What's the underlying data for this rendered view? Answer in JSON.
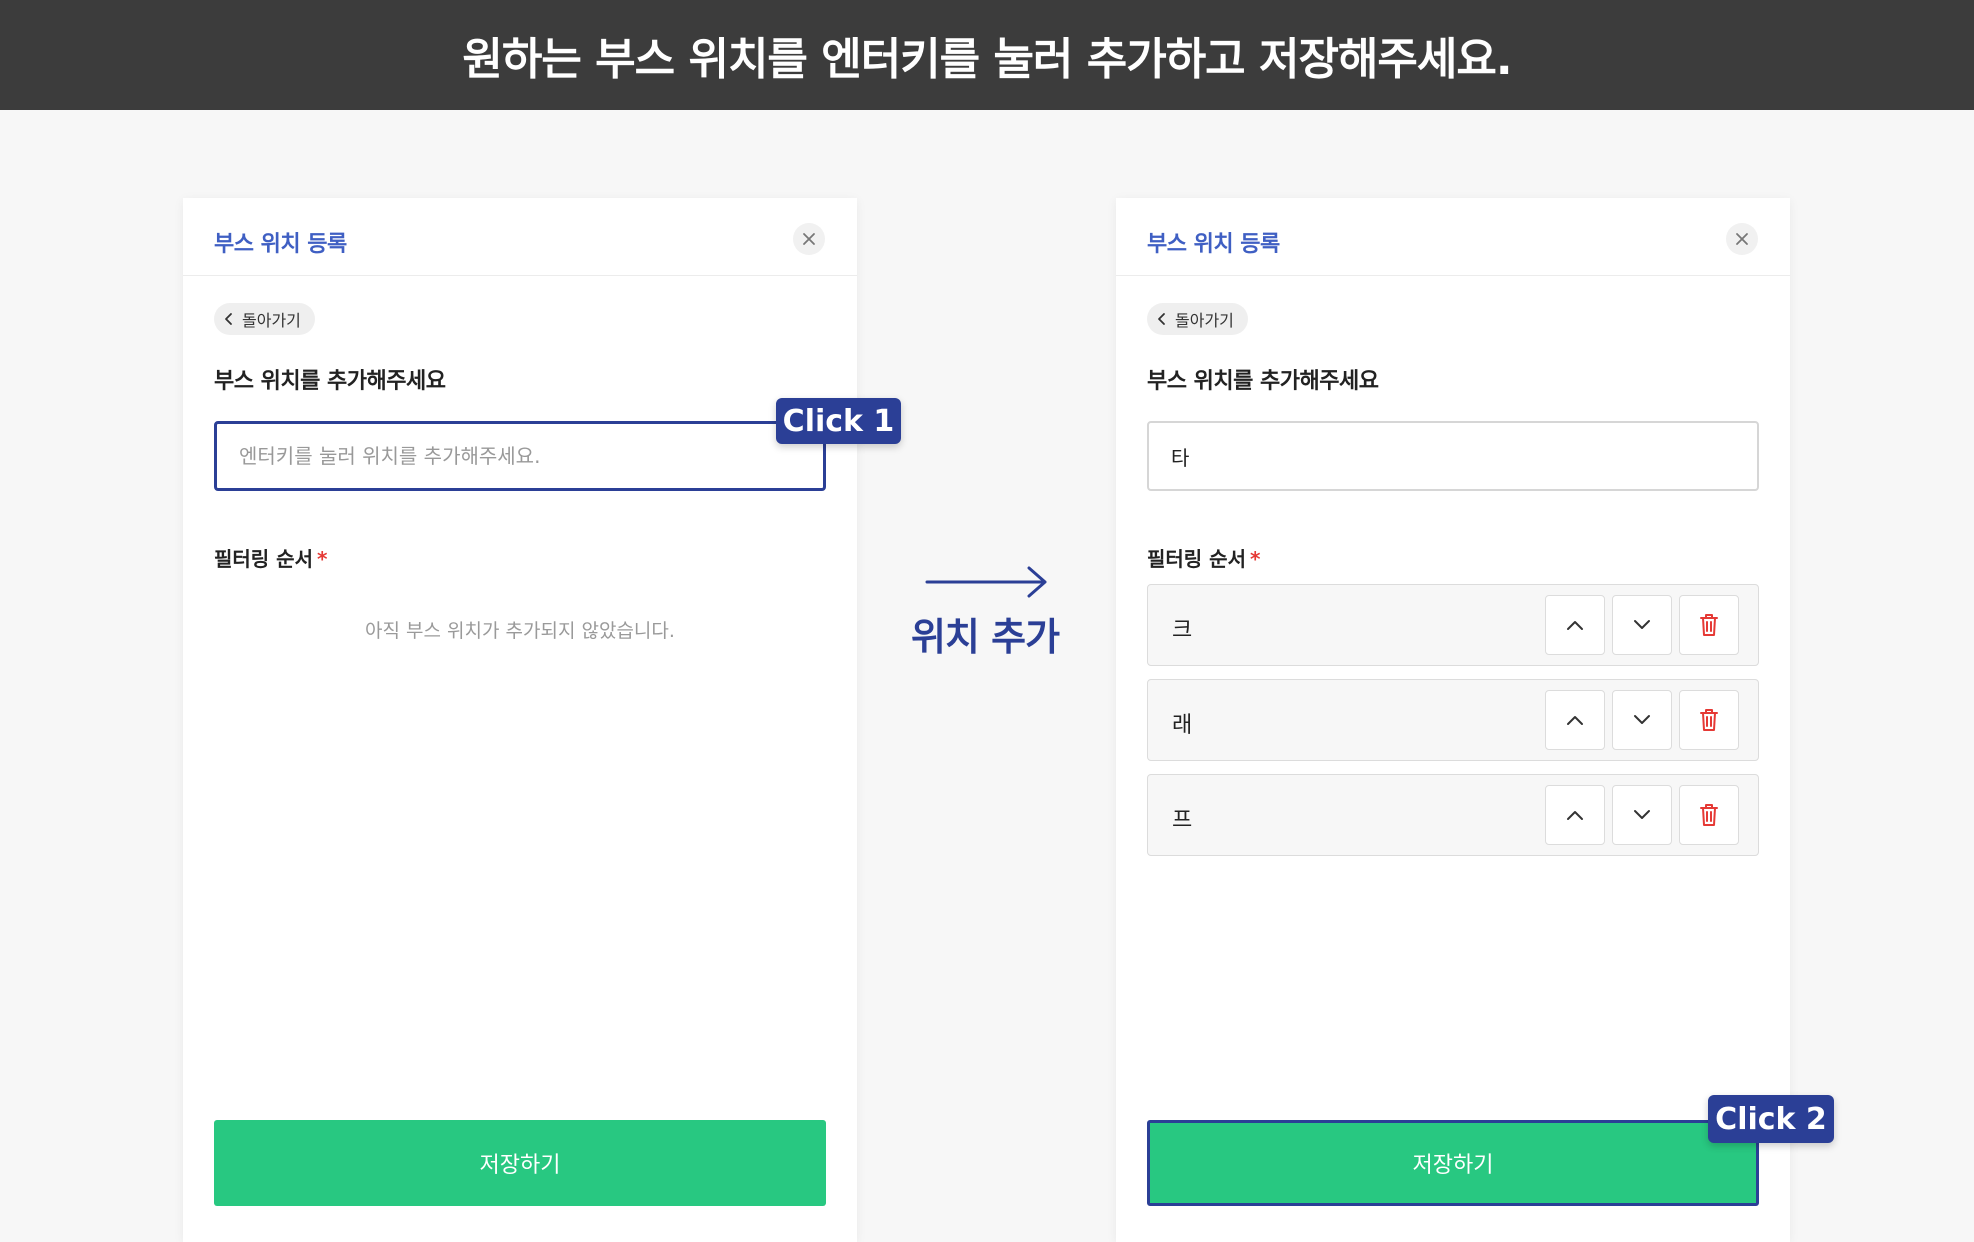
{
  "banner": {
    "text": "원하는 부스 위치를 엔터키를 눌러 추가하고 저장해주세요."
  },
  "step_label": "위치 추가",
  "badges": {
    "click1": "Click 1",
    "click2": "Click 2"
  },
  "left_panel": {
    "title": "부스 위치 등록",
    "back_label": "돌아가기",
    "section_label": "부스 위치를 추가해주세요",
    "input_placeholder": "엔터키를 눌러 위치를 추가해주세요.",
    "input_value": "",
    "filter_label": "필터링 순서",
    "required_mark": "*",
    "empty_message": "아직 부스 위치가 추가되지 않았습니다.",
    "save_label": "저장하기"
  },
  "right_panel": {
    "title": "부스 위치 등록",
    "back_label": "돌아가기",
    "section_label": "부스 위치를 추가해주세요",
    "input_value": "타",
    "filter_label": "필터링 순서",
    "required_mark": "*",
    "items": [
      {
        "label": "크"
      },
      {
        "label": "래"
      },
      {
        "label": "프"
      }
    ],
    "save_label": "저장하기"
  },
  "colors": {
    "accent": "#2b3f96",
    "title_blue": "#3f5fc3",
    "save_green": "#28c881",
    "delete_red": "#e53935",
    "banner_bg": "#3c3c3c"
  },
  "icons": [
    "close-icon",
    "chevron-left-icon",
    "chevron-up-icon",
    "chevron-down-icon",
    "trash-icon",
    "arrow-right-icon"
  ]
}
